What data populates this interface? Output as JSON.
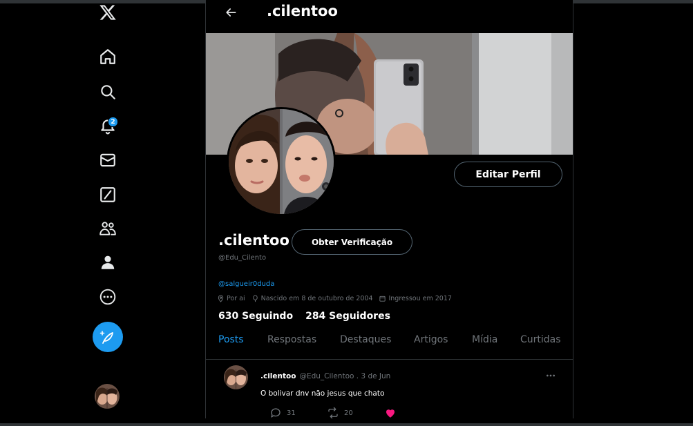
{
  "profile": {
    "header_title": ".cilentoo",
    "display_name": ".cilentoo",
    "handle": "@Edu_Cilento",
    "bio_link": "@salgueir0duda",
    "location": "Por ai",
    "birth": "Nascido em 8 de outubro de 2004",
    "joined": "Ingressou em 2017",
    "following": "630 Seguindo",
    "followers": "284 Seguidores",
    "edit_label": "Editar Perfil",
    "verify_label": "Obter Verificação"
  },
  "sidebar": {
    "notification_count": "2",
    "icons": [
      "x-logo-icon",
      "home-icon",
      "search-icon",
      "bell-icon",
      "mail-icon",
      "grok-icon",
      "communities-icon",
      "profile-icon",
      "more-icon",
      "compose-icon"
    ]
  },
  "tabs": [
    {
      "label": "Posts",
      "active": true
    },
    {
      "label": "Respostas"
    },
    {
      "label": "Destaques"
    },
    {
      "label": "Artigos"
    },
    {
      "label": "Mídia"
    },
    {
      "label": "Curtidas"
    }
  ],
  "post": {
    "name": ".cilentoo",
    "handle_date": "@Edu_Cilentoo . 3 de Jun",
    "text": "O bolivar dnv não jesus que chato",
    "replies": "31",
    "reposts": "20",
    "liked": true
  },
  "colors": {
    "accent": "#1d9bf0",
    "background": "#000000",
    "border": "#2f3336",
    "muted": "#71767b",
    "like": "#f91880"
  }
}
